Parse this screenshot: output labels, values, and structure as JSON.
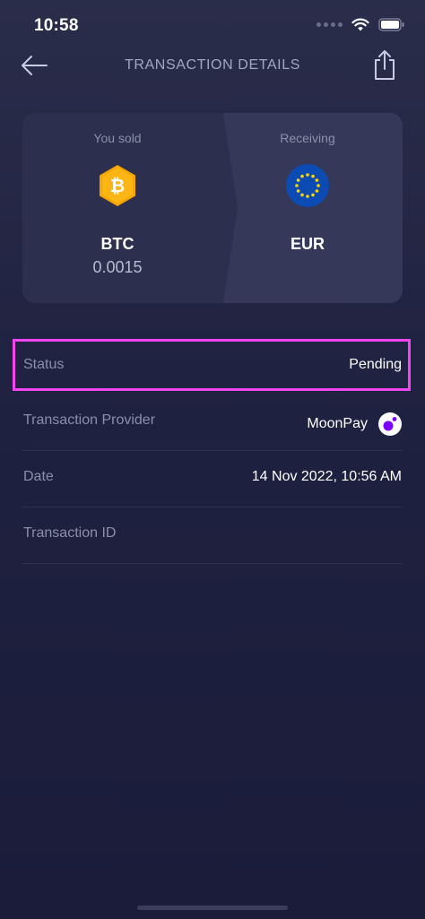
{
  "status_bar": {
    "time": "10:58"
  },
  "header": {
    "title": "TRANSACTION DETAILS"
  },
  "swap": {
    "from": {
      "label": "You sold",
      "symbol": "BTC",
      "amount": "0.0015",
      "icon": "bitcoin-icon",
      "color": "#f7a600"
    },
    "to": {
      "label": "Receiving",
      "symbol": "EUR",
      "icon": "eu-flag-icon",
      "color": "#0b4bb3"
    }
  },
  "details": [
    {
      "label": "Status",
      "value": "Pending"
    },
    {
      "label": "Transaction Provider",
      "value": "MoonPay",
      "icon": "moonpay-logo-icon"
    },
    {
      "label": "Date",
      "value": "14 Nov 2022, 10:56 AM"
    },
    {
      "label": "Transaction ID",
      "value": ""
    }
  ],
  "colors": {
    "background": "#1f2140",
    "highlight": "#f245f2",
    "muted_text": "#8c8fab"
  }
}
